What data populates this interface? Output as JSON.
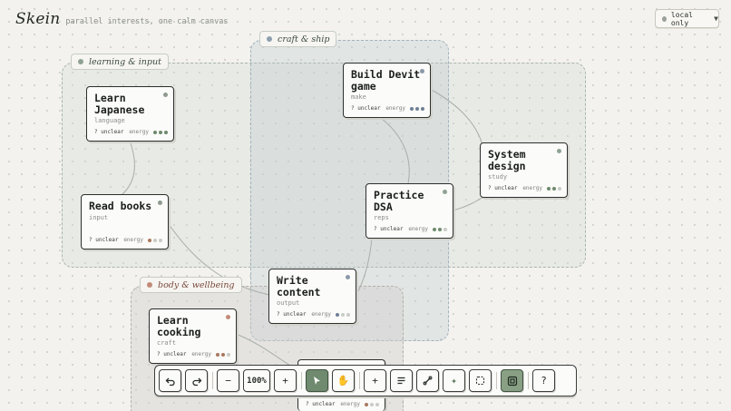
{
  "app": {
    "name": "Skein",
    "tagline": "parallel interests, one calm canvas"
  },
  "mode": {
    "label": "local only",
    "status_color": "#9aa198"
  },
  "groups": [
    {
      "label": "learning & input",
      "color": "#8ea293"
    },
    {
      "label": "craft & ship",
      "color": "#8d9fae"
    },
    {
      "label": "body & wellbeing",
      "color": "#c38b79"
    }
  ],
  "cards": [
    {
      "id": "learn-japanese",
      "title": "Learn Japanese",
      "tag": "language",
      "status": "? unclear",
      "energy_label": "energy",
      "energy_level": 3,
      "dot_color": "#8f9a90"
    },
    {
      "id": "read-books",
      "title": "Read books",
      "tag": "input",
      "status": "? unclear",
      "energy_label": "energy",
      "energy_level": 1,
      "dot_color": "#8f9a90"
    },
    {
      "id": "build-devit-game",
      "title": "Build Devit game",
      "tag": "make",
      "status": "? unclear",
      "energy_label": "energy",
      "energy_level": 3,
      "dot_color": "#8a99a8"
    },
    {
      "id": "practice-dsa",
      "title": "Practice DSA",
      "tag": "reps",
      "status": "? unclear",
      "energy_label": "energy",
      "energy_level": 2,
      "dot_color": "#8ea293"
    },
    {
      "id": "system-design",
      "title": "System design",
      "tag": "study",
      "status": "? unclear",
      "energy_label": "energy",
      "energy_level": 2,
      "dot_color": "#8ea293"
    },
    {
      "id": "write-content",
      "title": "Write content",
      "tag": "output",
      "status": "? unclear",
      "energy_label": "energy",
      "energy_level": 1,
      "dot_color": "#8a99a8"
    },
    {
      "id": "learn-cooking",
      "title": "Learn cooking",
      "tag": "craft",
      "status": "? unclear",
      "energy_label": "energy",
      "energy_level": 2,
      "dot_color": "#c38b79"
    },
    {
      "id": "hidden-card",
      "title": "",
      "tag": "",
      "status": "? unclear",
      "energy_label": "energy",
      "energy_level": 1,
      "dot_color": "#c38b79"
    }
  ],
  "energy_colors": {
    "on_green": "#6f8a6e",
    "on_blue": "#6f7f96",
    "on_brown": "#a9785f",
    "off": "#c9ccc7"
  },
  "toolbar": {
    "zoom_label": "100%",
    "buttons": [
      {
        "name": "undo-button",
        "icon": "undo-icon"
      },
      {
        "name": "redo-button",
        "icon": "redo-icon"
      },
      {
        "name": "zoom-out-button",
        "icon": "minus-icon"
      },
      {
        "name": "zoom-reset-button",
        "icon": "zoom-level"
      },
      {
        "name": "zoom-in-button",
        "icon": "plus-icon"
      },
      {
        "name": "select-tool-button",
        "icon": "cursor-icon",
        "active": true
      },
      {
        "name": "pan-tool-button",
        "icon": "hand-icon"
      },
      {
        "name": "add-card-button",
        "icon": "plus-icon"
      },
      {
        "name": "add-note-button",
        "icon": "lines-icon"
      },
      {
        "name": "connect-button",
        "icon": "link-icon"
      },
      {
        "name": "sparkle-button",
        "icon": "sparkle-icon"
      },
      {
        "name": "group-button",
        "icon": "dashed-square-icon"
      },
      {
        "name": "focus-button",
        "icon": "frame-icon",
        "active": true
      },
      {
        "name": "help-button",
        "icon": "question-icon"
      }
    ]
  }
}
